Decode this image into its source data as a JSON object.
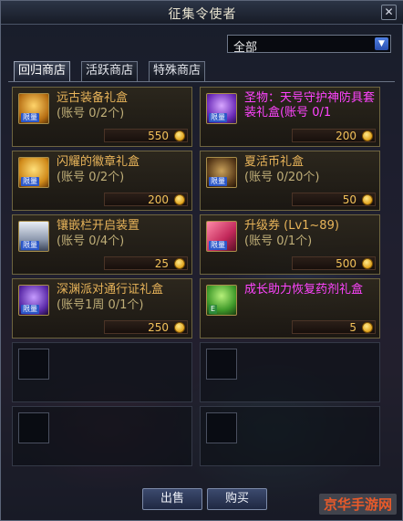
{
  "window": {
    "title": "征集令使者",
    "close_glyph": "✕"
  },
  "filter": {
    "selected": "全部",
    "arrow_glyph": "▼"
  },
  "tabs": [
    {
      "label": "回归商店",
      "active": true
    },
    {
      "label": "活跃商店",
      "active": false
    },
    {
      "label": "特殊商店",
      "active": false
    }
  ],
  "items": [
    {
      "name": "远古装备礼盒",
      "sub": "(账号 0/2个)",
      "price": "550",
      "badge": "限量",
      "name_color": "#e8b45a",
      "icon": "golden-chest-icon"
    },
    {
      "name": "圣物：天号守护神防具套装礼盒(账号 0/1",
      "sub": "",
      "price": "200",
      "badge": "限量",
      "name_color": "#ff44ff",
      "icon": "purple-chest-icon"
    },
    {
      "name": "闪耀的徽章礼盒",
      "sub": "(账号 0/2个)",
      "price": "200",
      "badge": "限量",
      "name_color": "#e8b45a",
      "icon": "golden-badge-box-icon"
    },
    {
      "name": "夏活币礼盒",
      "sub": "(账号 0/20个)",
      "price": "50",
      "badge": "限量",
      "name_color": "#e8b45a",
      "icon": "coin-bag-icon"
    },
    {
      "name": "镶嵌栏开启装置",
      "sub": "(账号 0/4个)",
      "price": "25",
      "badge": "限量",
      "name_color": "#e8b45a",
      "icon": "socket-device-icon"
    },
    {
      "name": "升级券 (Lv1~89)",
      "sub": "(账号 0/1个)",
      "price": "500",
      "badge": "限量",
      "name_color": "#e8b45a",
      "icon": "level-ticket-icon"
    },
    {
      "name": "深渊派对通行证礼盒",
      "sub": "(账号1周 0/1个)",
      "price": "250",
      "badge": "限量",
      "name_color": "#e8b45a",
      "icon": "abyss-pass-box-icon"
    },
    {
      "name": "成长助力恢复药剂礼盒",
      "sub": "",
      "price": "5",
      "badge": "E",
      "name_color": "#ff44ff",
      "icon": "potion-tree-icon"
    }
  ],
  "buttons": {
    "sell": "出售",
    "buy": "购买"
  },
  "watermark": "京华手游网",
  "colors": {
    "price": "#f3c25a",
    "accent_blue": "#2b57c9"
  }
}
